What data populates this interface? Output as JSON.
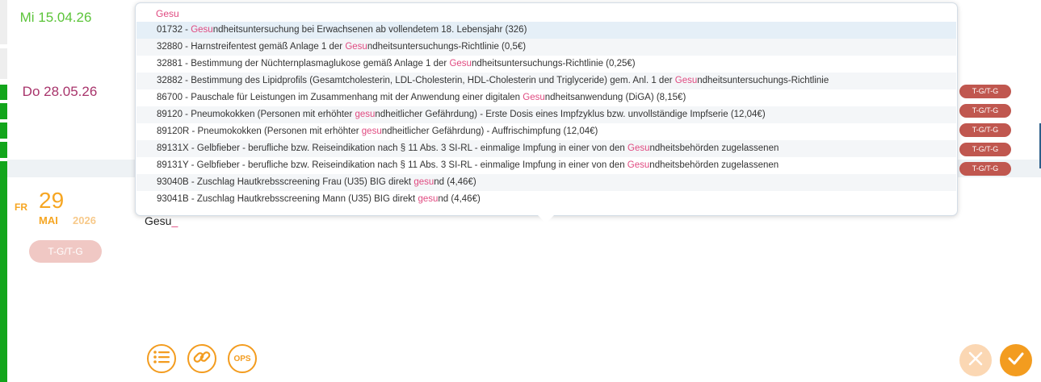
{
  "history": {
    "dates": [
      {
        "label": "Mi 15.04.26",
        "color": "#5cc43a"
      },
      {
        "label": "Do 28.05.26",
        "color": "#a8346b"
      }
    ],
    "pills": [
      "T-G/T-G",
      "T-G/T-G",
      "T-G/T-G",
      "T-G/T-G",
      "T-G/T-G"
    ]
  },
  "current": {
    "weekday": "FR",
    "day": "29",
    "month": "MAI",
    "year": "2026",
    "pill": "T-G/T-G"
  },
  "entry": {
    "text": "Gesu",
    "cursor": "_"
  },
  "autocomplete": {
    "query": "Gesu",
    "selected_index": 0,
    "items": [
      {
        "pre": "01732 - ",
        "match": "Gesu",
        "post": "ndheitsuntersuchung bei Erwachsenen ab vollendetem 18. Lebensjahr (326)"
      },
      {
        "pre": "32880 - Harnstreifentest gemäß Anlage 1 der ",
        "match": "Gesu",
        "post": "ndheitsuntersuchungs-Richtlinie (0,5€)"
      },
      {
        "pre": "32881 - Bestimmung der Nüchternplasmaglukose gemäß Anlage 1 der ",
        "match": "Gesu",
        "post": "ndheitsuntersuchungs-Richtlinie (0,25€)"
      },
      {
        "pre": "32882 - Bestimmung des Lipidprofils (Gesamtcholesterin, LDL-Cholesterin, HDL-Cholesterin und Triglyceride) gem. Anl. 1 der ",
        "match": "Gesu",
        "post": "ndheitsuntersuchungs-Richtlinie"
      },
      {
        "pre": "86700 - Pauschale für Leistungen im Zusammenhang mit der Anwendung einer digitalen ",
        "match": "Gesu",
        "post": "ndheitsanwendung (DiGA) (8,15€)"
      },
      {
        "pre": "89120 - Pneumokokken (Personen mit erhöhter ",
        "match": "gesu",
        "post": "ndheitlicher Gefährdung) - Erste Dosis eines Impfzyklus bzw. unvollständige Impfserie (12,04€)"
      },
      {
        "pre": "89120R - Pneumokokken (Personen mit erhöhter ",
        "match": "gesu",
        "post": "ndheitlicher Gefährdung) - Auffrischimpfung (12,04€)"
      },
      {
        "pre": "89131X - Gelbfieber - berufliche bzw. Reiseindikation nach § 11 Abs. 3 SI-RL - einmalige Impfung in einer von den ",
        "match": "Gesu",
        "post": "ndheitsbehörden zugelassenen"
      },
      {
        "pre": "89131Y - Gelbfieber - berufliche bzw. Reiseindikation nach § 11 Abs. 3 SI-RL - einmalige Impfung in einer von den ",
        "match": "Gesu",
        "post": "ndheitsbehörden zugelassenen"
      },
      {
        "pre": "93040B - Zuschlag Hautkrebsscreening Frau (U35) BIG direkt ",
        "match": "gesu",
        "post": "nd (4,46€)"
      },
      {
        "pre": "93041B - Zuschlag Hautkrebsscreening Mann (U35) BIG direkt ",
        "match": "gesu",
        "post": "nd (4,46€)"
      }
    ]
  },
  "toolbar": {
    "list_icon": "list-icon",
    "link_icon": "link-icon",
    "ops_label": "OPS",
    "cancel_icon": "close-icon",
    "confirm_icon": "check-icon"
  },
  "colors": {
    "accent": "#f39c1f",
    "highlight": "#e04a80",
    "pill": "#c0574f",
    "status_green": "#12a51b"
  }
}
